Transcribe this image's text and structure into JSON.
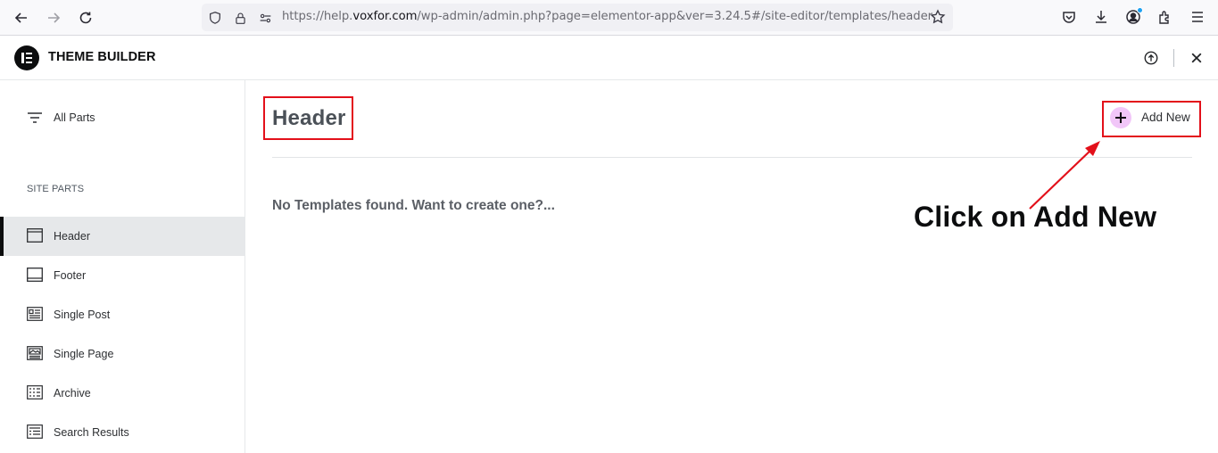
{
  "browser": {
    "url_prefix": "https://help.",
    "url_host": "voxfor.com",
    "url_path": "/wp-admin/admin.php?page=elementor-app&ver=3.24.5#/site-editor/templates/header",
    "icons": [
      "back-icon",
      "forward-icon",
      "reload-icon",
      "shield-icon",
      "lock-icon",
      "permissions-icon",
      "bookmark-star-icon",
      "pocket-icon",
      "download-icon",
      "account-icon",
      "extensions-icon",
      "menu-icon"
    ]
  },
  "app": {
    "title": "THEME BUILDER",
    "icons": [
      "elementor-logo-icon",
      "info-icon",
      "close-icon"
    ]
  },
  "sidebar": {
    "all_parts": "All Parts",
    "section_title": "SITE PARTS",
    "items": [
      {
        "label": "Header",
        "icon": "header-icon",
        "active": true
      },
      {
        "label": "Footer",
        "icon": "footer-icon",
        "active": false
      },
      {
        "label": "Single Post",
        "icon": "single-post-icon",
        "active": false
      },
      {
        "label": "Single Page",
        "icon": "single-page-icon",
        "active": false
      },
      {
        "label": "Archive",
        "icon": "archive-icon",
        "active": false
      },
      {
        "label": "Search Results",
        "icon": "search-results-icon",
        "active": false
      }
    ]
  },
  "main": {
    "page_title": "Header",
    "add_new_label": "Add New",
    "empty_message": "No Templates found. Want to create one?...",
    "annotation": "Click on Add New"
  },
  "colors": {
    "highlight_red": "#e3101a",
    "add_icon_bg": "#f1c6f8",
    "active_bg": "#e6e8ea"
  }
}
